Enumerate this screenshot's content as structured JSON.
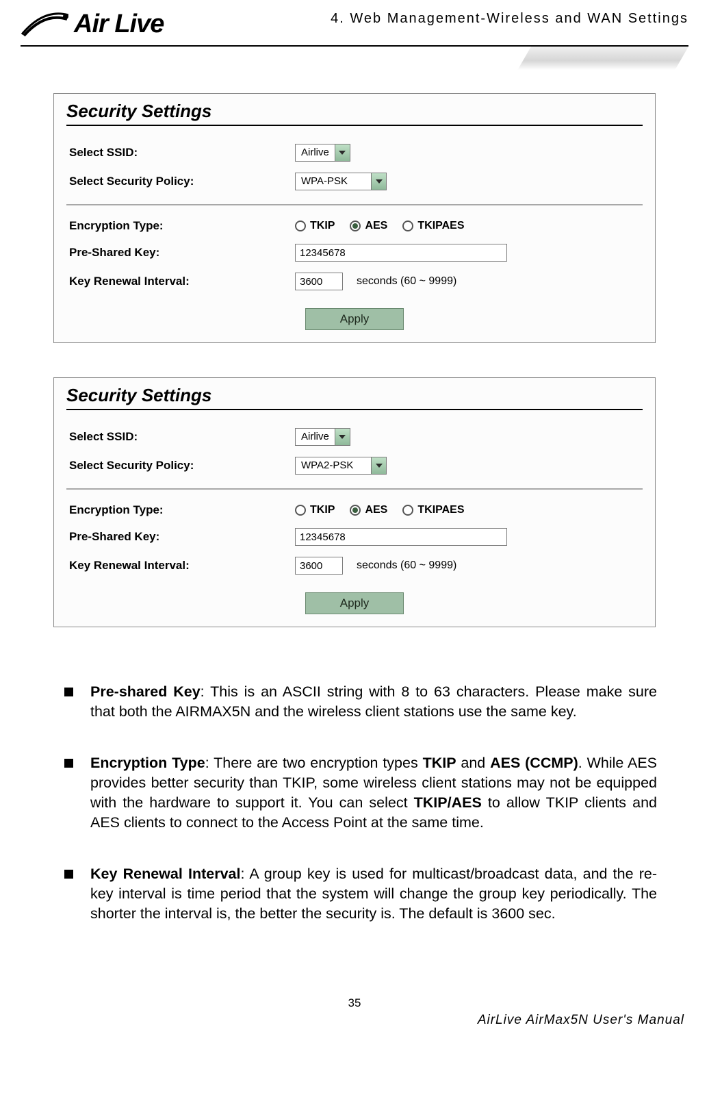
{
  "header": {
    "logo_text": "Air Live",
    "chapter": "4. Web Management-Wireless and WAN Settings"
  },
  "panels": [
    {
      "title": "Security Settings",
      "rows": {
        "ssid_label": "Select SSID:",
        "ssid_value": "Airlive",
        "policy_label": "Select Security Policy:",
        "policy_value": "WPA-PSK",
        "enc_label": "Encryption Type:",
        "enc_options": [
          "TKIP",
          "AES",
          "TKIPAES"
        ],
        "enc_selected": "AES",
        "psk_label": "Pre-Shared Key:",
        "psk_value": "12345678",
        "renew_label": "Key Renewal Interval:",
        "renew_value": "3600",
        "renew_suffix": "seconds   (60 ~ 9999)"
      },
      "apply": "Apply"
    },
    {
      "title": "Security Settings",
      "rows": {
        "ssid_label": "Select SSID:",
        "ssid_value": "Airlive",
        "policy_label": "Select Security Policy:",
        "policy_value": "WPA2-PSK",
        "enc_label": "Encryption Type:",
        "enc_options": [
          "TKIP",
          "AES",
          "TKIPAES"
        ],
        "enc_selected": "AES",
        "psk_label": "Pre-Shared Key:",
        "psk_value": "12345678",
        "renew_label": "Key Renewal Interval:",
        "renew_value": "3600",
        "renew_suffix": "seconds   (60 ~ 9999)"
      },
      "apply": "Apply"
    }
  ],
  "bullets": {
    "psk": {
      "term": "Pre-shared Key",
      "text": ": This is an ASCII string with 8 to 63 characters. Please make sure that both the AIRMAX5N and the wireless client stations use the same key."
    },
    "enc": {
      "term": "Encryption Type",
      "pre": ": There are two encryption types ",
      "t1": "TKIP",
      "mid1": " and ",
      "t2": "AES (CCMP)",
      "post1": ". While AES provides better security than TKIP, some wireless client stations may not be equipped with the hardware to support it. You can select ",
      "t3": "TKIP/AES",
      "post2": " to allow TKIP clients and AES clients to connect to the Access Point at the same time."
    },
    "renew": {
      "term": "Key Renewal Interval",
      "text": ": A group key is used for multicast/broadcast data, and the re-key interval is time period that the system will change the group key periodically. The shorter the interval is, the better the security is. The default is 3600 sec."
    }
  },
  "footer": {
    "page": "35",
    "manual": "AirLive AirMax5N User's Manual"
  }
}
